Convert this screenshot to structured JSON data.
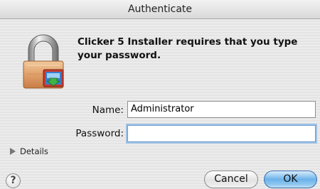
{
  "window": {
    "title": "Authenticate"
  },
  "dialog": {
    "message": "Clicker 5 Installer requires that you type your password.",
    "name_label": "Name:",
    "name_value": "Administrator",
    "password_label": "Password:",
    "password_value": "",
    "details_label": "Details",
    "help_label": "?",
    "cancel_label": "Cancel",
    "ok_label": "OK"
  },
  "icons": {
    "lock": "padlock-icon",
    "installer": "installer-package-icon",
    "disclosure": "disclosure-triangle-icon"
  },
  "colors": {
    "ok_button": "#6bb3ea",
    "focus_ring": "#9ec2e6",
    "lock_body": "#e8b07a"
  }
}
